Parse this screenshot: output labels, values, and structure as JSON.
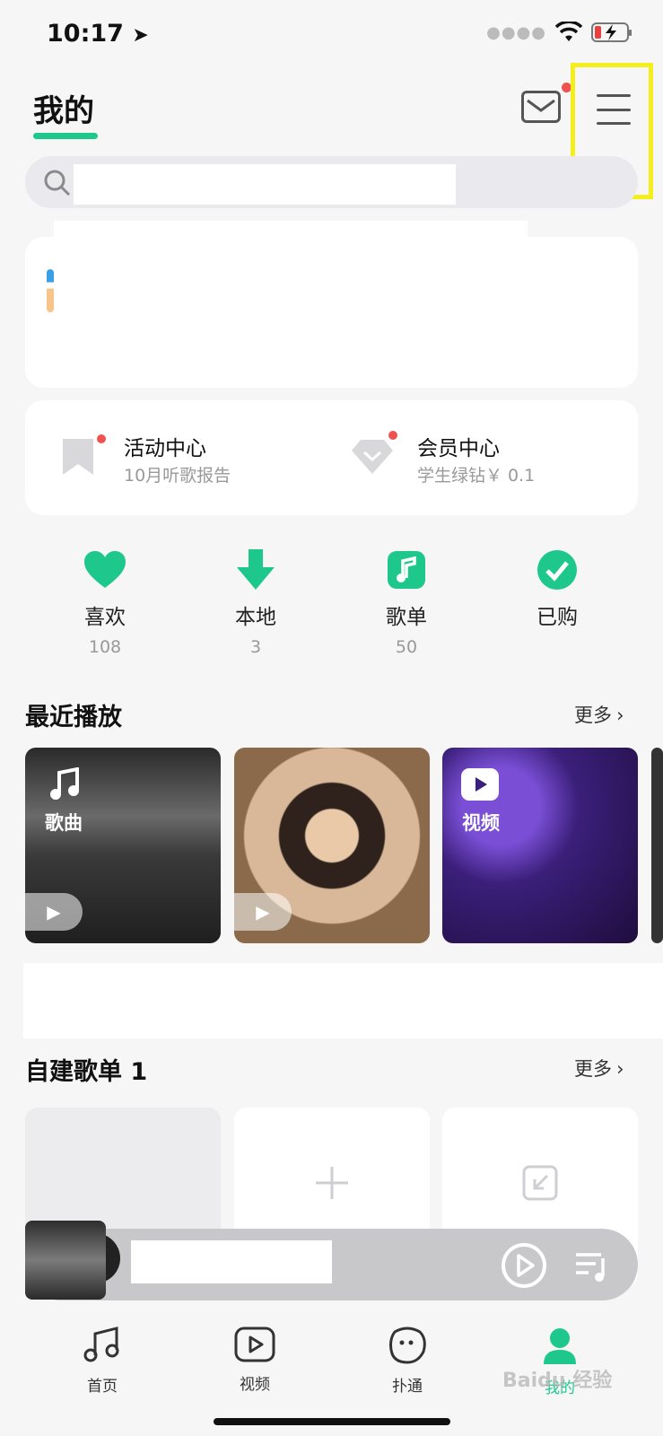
{
  "status": {
    "time": "10:17"
  },
  "header": {
    "title": "我的"
  },
  "search": {
    "placeholder": ""
  },
  "services": [
    {
      "title": "活动中心",
      "subtitle": "10月听歌报告"
    },
    {
      "title": "会员中心",
      "subtitle": "学生绿钻￥ 0.1"
    }
  ],
  "quick": [
    {
      "label": "喜欢",
      "count": "108",
      "icon": "heart-icon"
    },
    {
      "label": "本地",
      "count": "3",
      "icon": "download-icon"
    },
    {
      "label": "歌单",
      "count": "50",
      "icon": "playlist-icon"
    },
    {
      "label": "已购",
      "count": "",
      "icon": "check-icon"
    }
  ],
  "recent": {
    "title": "最近播放",
    "more": "更多",
    "tiles": [
      {
        "label": "歌曲"
      },
      {
        "label": ""
      },
      {
        "label": "视频"
      }
    ]
  },
  "playlists": {
    "title": "自建歌单 1",
    "more": "更多"
  },
  "tabs": [
    {
      "label": "首页"
    },
    {
      "label": "视频"
    },
    {
      "label": "扑通"
    },
    {
      "label": "我的"
    }
  ],
  "watermark": "Baidu 经验",
  "colors": {
    "accent": "#1ec88d",
    "badge": "#f0524f",
    "highlight": "#f4ef1c"
  }
}
